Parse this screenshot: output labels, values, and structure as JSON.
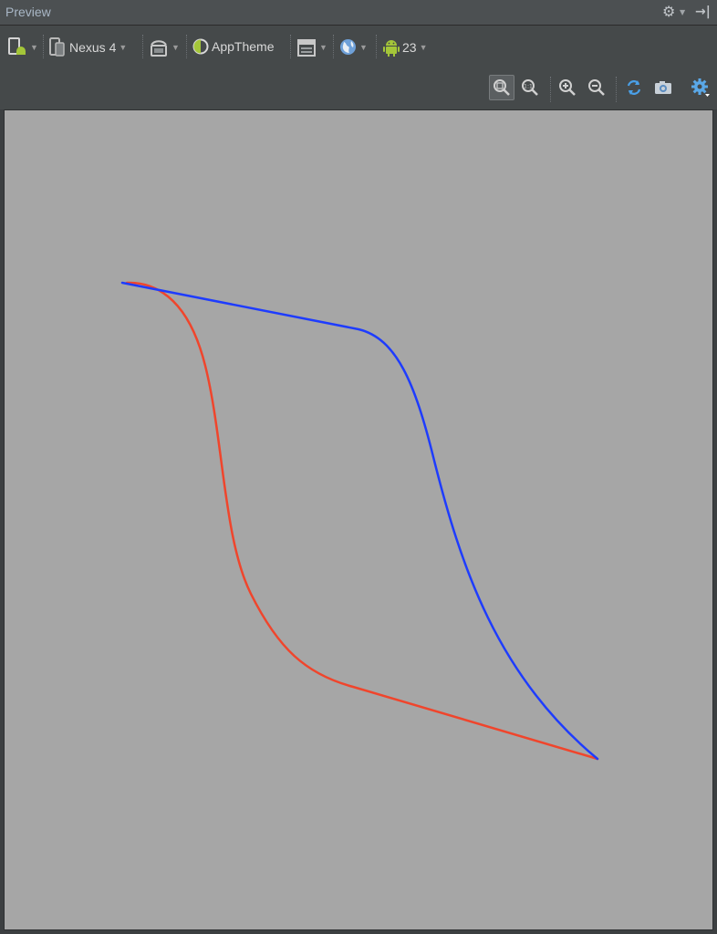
{
  "panel": {
    "title": "Preview"
  },
  "toolbar": {
    "device": "Nexus 4",
    "theme": "AppTheme",
    "api_level": "23"
  },
  "colors": {
    "red_curve": "#f0452c",
    "blue_curve": "#1e3cff",
    "canvas_bg": "#a6a6a6",
    "android_green": "#a4c639"
  }
}
